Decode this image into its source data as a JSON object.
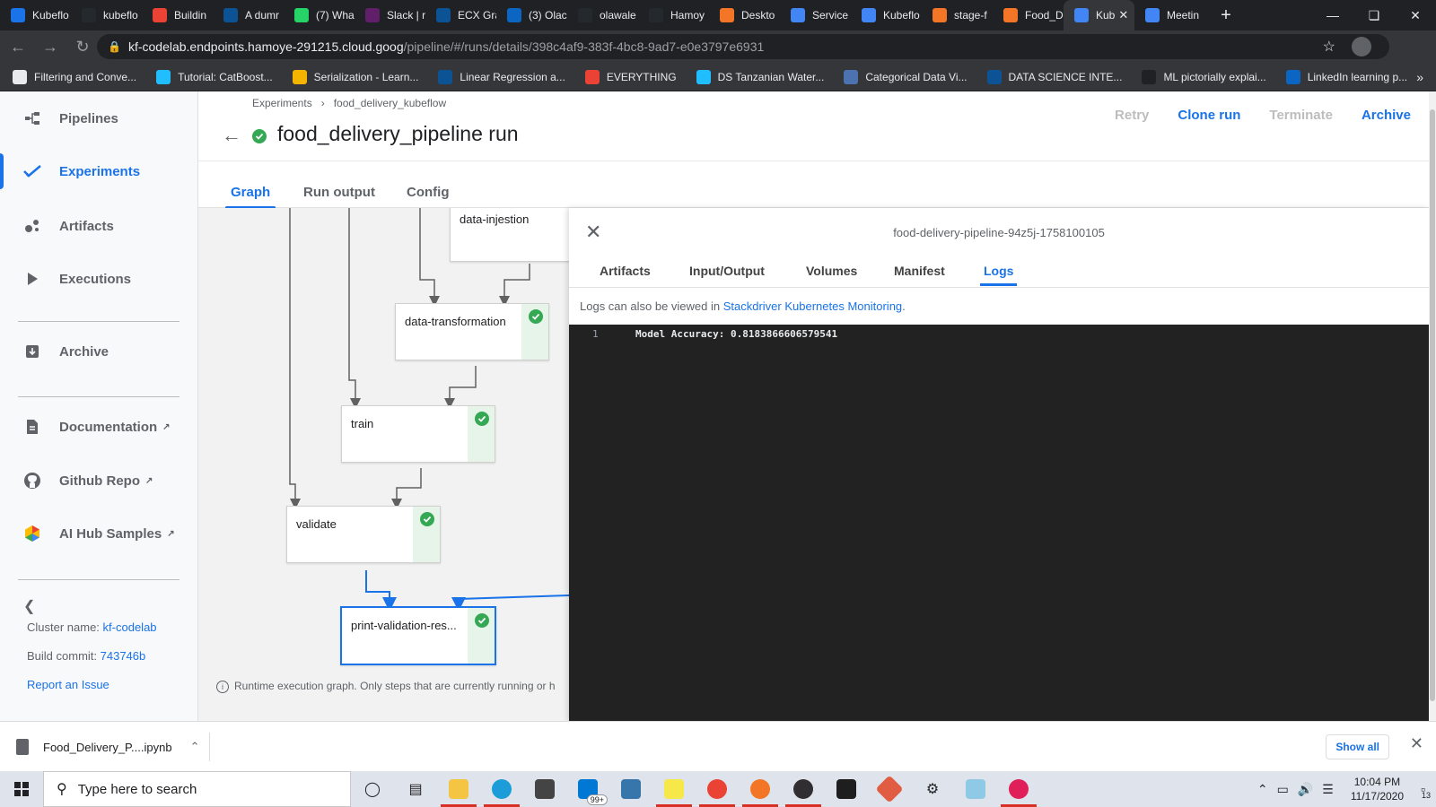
{
  "browser": {
    "tabs": [
      {
        "label": "Kubeflo",
        "color": "#1a73e8"
      },
      {
        "label": "kubeflo",
        "color": "#24292e"
      },
      {
        "label": "Buildin",
        "color": "#ea4335"
      },
      {
        "label": "A dumr",
        "color": "#0b5394"
      },
      {
        "label": "(7) Wha",
        "color": "#25d366"
      },
      {
        "label": "Slack | r",
        "color": "#611f69"
      },
      {
        "label": "ECX Gra",
        "color": "#0b5394"
      },
      {
        "label": "(3) Olac",
        "color": "#0a66c2"
      },
      {
        "label": "olawale",
        "color": "#24292e"
      },
      {
        "label": "Hamoy",
        "color": "#24292e"
      },
      {
        "label": "Deskto",
        "color": "#f37626"
      },
      {
        "label": "Service",
        "color": "#4285f4"
      },
      {
        "label": "Kubeflo",
        "color": "#4285f4"
      },
      {
        "label": "stage-f",
        "color": "#f37626"
      },
      {
        "label": "Food_D",
        "color": "#f37626"
      },
      {
        "label": "Kub",
        "color": "#4285f4"
      },
      {
        "label": "Meetin",
        "color": "#4285f4"
      }
    ],
    "active_tab_index": 15,
    "url_host": "kf-codelab.endpoints.hamoye-291215.cloud.goog",
    "url_path": "/pipeline/#/runs/details/398c4af9-383f-4bc8-9ad7-e0e3797e6931",
    "bookmarks": [
      {
        "label": "Filtering and Conve...",
        "color": "#e8eaed"
      },
      {
        "label": "Tutorial: CatBoost...",
        "color": "#20beff"
      },
      {
        "label": "Serialization - Learn...",
        "color": "#f4b400"
      },
      {
        "label": "Linear Regression a...",
        "color": "#0b5394"
      },
      {
        "label": "EVERYTHING",
        "color": "#ea4335"
      },
      {
        "label": "DS Tanzanian Water...",
        "color": "#20beff"
      },
      {
        "label": "Categorical Data Vi...",
        "color": "#4c72b0"
      },
      {
        "label": "DATA SCIENCE INTE...",
        "color": "#0b5394"
      },
      {
        "label": "ML pictorially explai...",
        "color": "#202124"
      },
      {
        "label": "LinkedIn learning p...",
        "color": "#0a66c2"
      }
    ]
  },
  "sidebar": {
    "items": [
      {
        "label": "Pipelines",
        "icon": "pipelines-icon"
      },
      {
        "label": "Experiments",
        "icon": "experiments-icon"
      },
      {
        "label": "Artifacts",
        "icon": "artifacts-icon"
      },
      {
        "label": "Executions",
        "icon": "executions-icon"
      },
      {
        "label": "Archive",
        "icon": "archive-icon"
      },
      {
        "label": "Documentation",
        "icon": "documentation-icon"
      },
      {
        "label": "Github Repo",
        "icon": "github-icon"
      },
      {
        "label": "AI Hub Samples",
        "icon": "ai-hub-icon"
      }
    ],
    "cluster_label": "Cluster name: ",
    "cluster_value": "kf-codelab",
    "build_label": "Build commit: ",
    "build_value": "743746b",
    "report_issue": "Report an Issue"
  },
  "header": {
    "breadcrumb": [
      "Experiments",
      "food_delivery_kubeflow"
    ],
    "breadcrumb_sep": "›",
    "title": "food_delivery_pipeline run",
    "actions": {
      "retry": "Retry",
      "clone": "Clone run",
      "terminate": "Terminate",
      "archive": "Archive"
    }
  },
  "main_tabs": [
    "Graph",
    "Run output",
    "Config"
  ],
  "graph": {
    "nodes": [
      {
        "label": "data-injestion",
        "status": "none"
      },
      {
        "label": "data-transformation",
        "status": "succeeded"
      },
      {
        "label": "train",
        "status": "succeeded"
      },
      {
        "label": "validate",
        "status": "succeeded"
      },
      {
        "label": "print-validation-res...",
        "status": "succeeded"
      }
    ],
    "note": "Runtime execution graph. Only steps that are currently running or h"
  },
  "panel": {
    "title": "food-delivery-pipeline-94z5j-1758100105",
    "tabs": [
      "Artifacts",
      "Input/Output",
      "Volumes",
      "Manifest",
      "Logs"
    ],
    "active_tab": "Logs",
    "hint_prefix": "Logs can also be viewed in ",
    "hint_link": "Stackdriver Kubernetes Monitoring",
    "hint_suffix": ".",
    "log_lines": [
      {
        "n": "1",
        "text": "Model Accuracy: 0.8183866606579541"
      }
    ]
  },
  "downloads": {
    "file": "Food_Delivery_P....ipynb",
    "show_all": "Show all"
  },
  "taskbar": {
    "search_placeholder": "Type here to search",
    "time": "10:04 PM",
    "date": "11/17/2020",
    "mail_badge": "99+",
    "notif_count": "13"
  }
}
